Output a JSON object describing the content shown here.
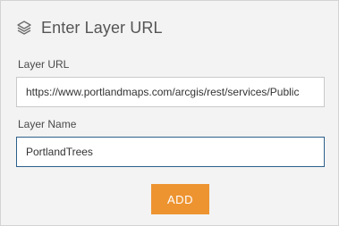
{
  "header": {
    "icon": "layers-icon",
    "title": "Enter Layer URL"
  },
  "form": {
    "url_label": "Layer URL",
    "url_value": "https://www.portlandmaps.com/arcgis/rest/services/Public",
    "name_label": "Layer Name",
    "name_value": "PortlandTrees",
    "add_label": "ADD"
  },
  "colors": {
    "panel_bg": "#f3f3f3",
    "button_bg": "#ed9431",
    "focus_border": "#2d5f8a"
  }
}
